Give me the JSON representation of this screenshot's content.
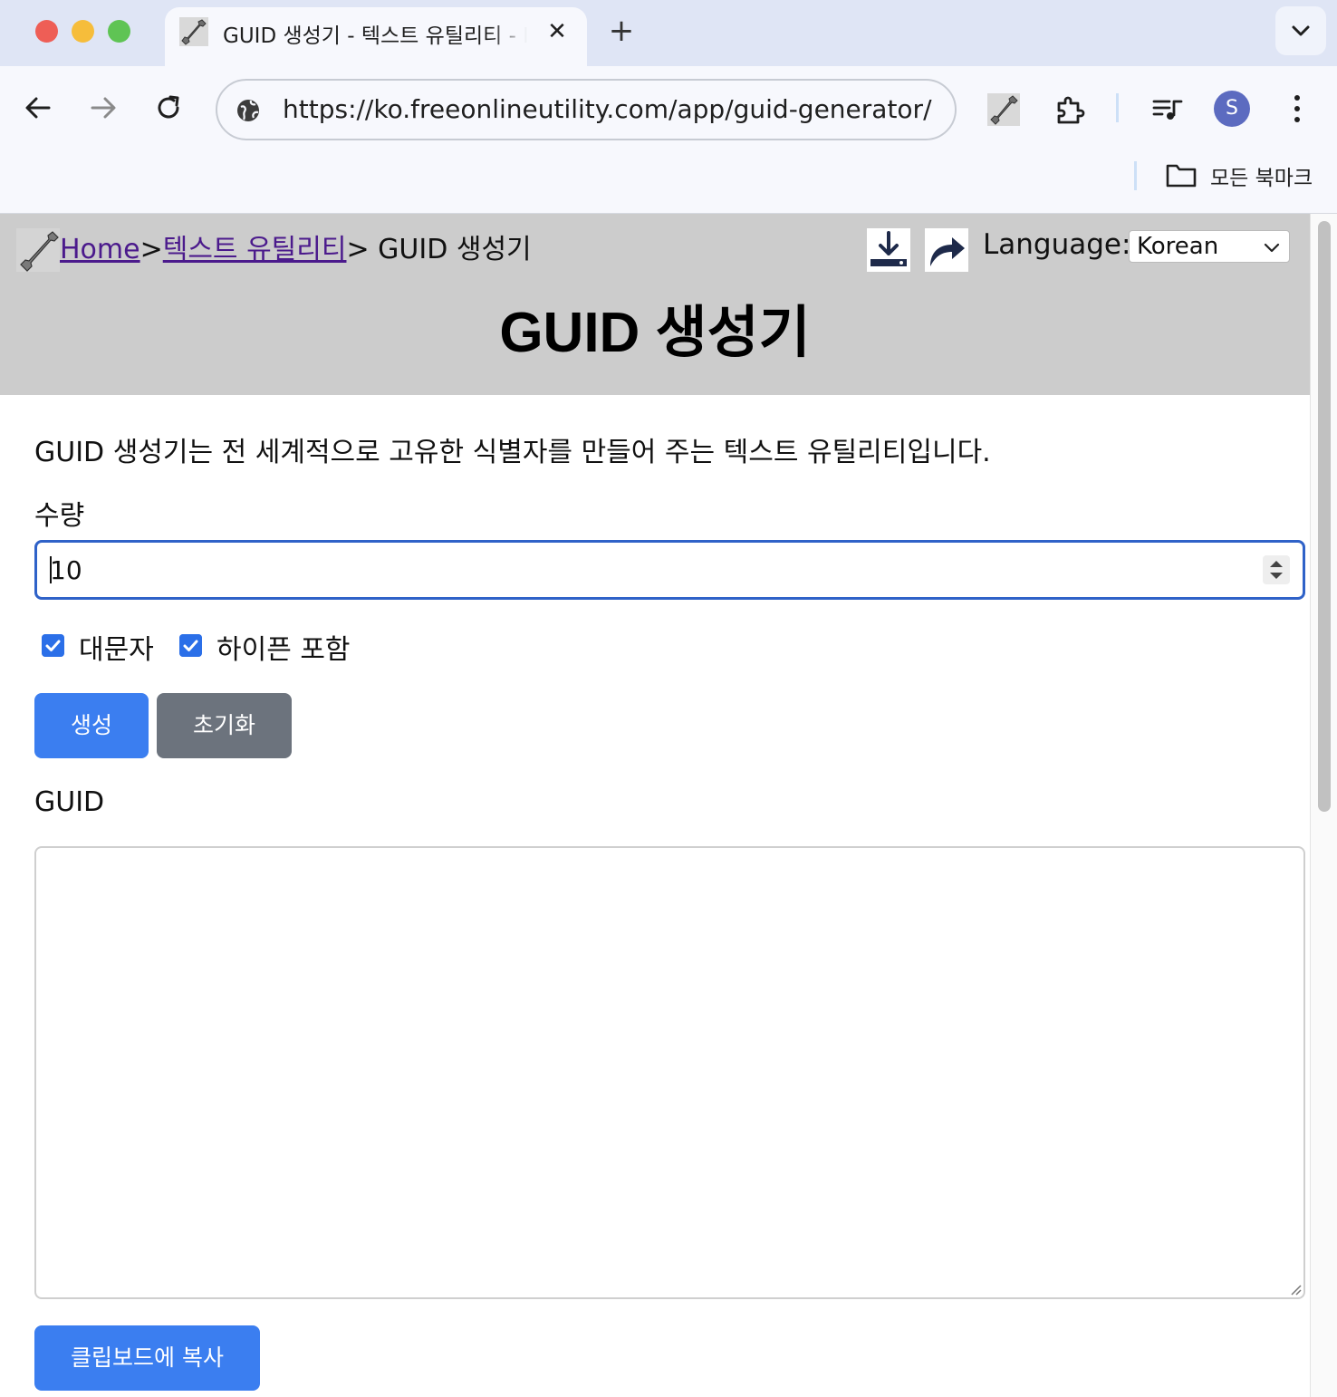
{
  "browser": {
    "tab": {
      "title": "GUID 생성기 - 텍스트 유틸리티 - Free Online Utility",
      "close_glyph": "✕"
    },
    "new_tab_glyph": "+",
    "url": "https://ko.freeonlineutility.com/app/guid-generator/",
    "profile_initial": "S",
    "bookmarks": {
      "all_bookmarks_label": "모든 북마크"
    }
  },
  "header": {
    "breadcrumb": {
      "home": "Home",
      "separator": ">",
      "category": "텍스트 유틸리티",
      "current": "> GUID 생성기"
    },
    "language_label": "Language:",
    "language_selected": "Korean",
    "title": "GUID 생성기"
  },
  "main": {
    "intro": "GUID 생성기는 전 세계적으로 고유한 식별자를 만들어 주는 텍스트 유틸리티입니다.",
    "quantity_label": "수량",
    "quantity_value": "10",
    "options": [
      {
        "label": "대문자",
        "checked": true
      },
      {
        "label": "하이픈 포함",
        "checked": true
      }
    ],
    "generate_label": "생성",
    "reset_label": "초기화",
    "output_label": "GUID",
    "output_value": "",
    "copy_label": "클립보드에 복사"
  },
  "colors": {
    "primary_button": "#3b7ef0",
    "secondary_button": "#6c737d",
    "header_bg": "#cccccc",
    "focus_border": "#2f62c8",
    "breadcrumb_link": "#4b1a8c"
  }
}
